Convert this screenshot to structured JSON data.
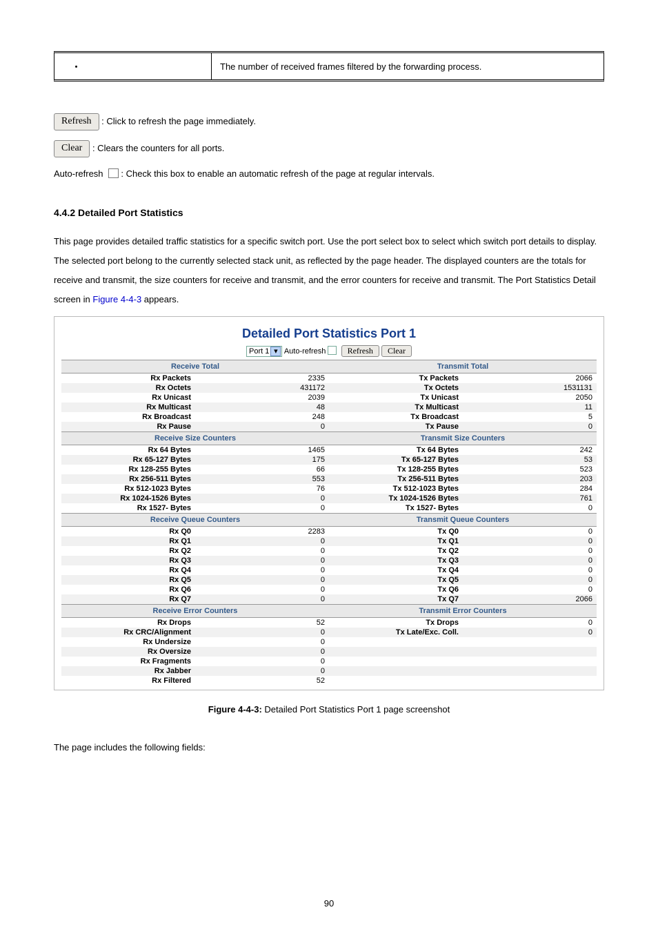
{
  "top_row": {
    "desc": "The number of received frames filtered by the forwarding process."
  },
  "buttons": {
    "refresh": "Refresh",
    "clear": "Clear",
    "refresh_desc": "Click to refresh the page immediately.",
    "clear_desc": ": Clears the counters for all ports.",
    "autorefresh_prefix": "Auto-refresh",
    "autorefresh_desc": ": Check this box to enable an automatic refresh of the page at regular intervals."
  },
  "section": {
    "heading": "4.4.2 Detailed Port Statistics",
    "para": "This page provides detailed traffic statistics for a specific switch port. Use the port select box to select which switch port details to display. The selected port belong to the currently selected stack unit, as reflected by the page header. The displayed counters are the totals for receive and transmit, the size counters for receive and transmit, and the error counters for receive and transmit. The Port Statistics Detail screen in ",
    "figref": "Figure 4-4-3",
    "para_tail": " appears."
  },
  "shot": {
    "title": "Detailed Port Statistics  Port 1",
    "port_select": "Port 1",
    "autorefresh_label": "Auto-refresh",
    "refresh": "Refresh",
    "clear": "Clear",
    "groups": {
      "rx_total": "Receive Total",
      "tx_total": "Transmit Total",
      "rx_size": "Receive Size Counters",
      "tx_size": "Transmit Size Counters",
      "rx_queue": "Receive Queue Counters",
      "tx_queue": "Transmit Queue Counters",
      "rx_err": "Receive Error Counters",
      "tx_err": "Transmit Error Counters"
    },
    "rows": {
      "total": [
        {
          "rl": "Rx Packets",
          "rv": "2335",
          "tl": "Tx Packets",
          "tv": "2066"
        },
        {
          "rl": "Rx Octets",
          "rv": "431172",
          "tl": "Tx Octets",
          "tv": "1531131"
        },
        {
          "rl": "Rx Unicast",
          "rv": "2039",
          "tl": "Tx Unicast",
          "tv": "2050"
        },
        {
          "rl": "Rx Multicast",
          "rv": "48",
          "tl": "Tx Multicast",
          "tv": "11"
        },
        {
          "rl": "Rx Broadcast",
          "rv": "248",
          "tl": "Tx Broadcast",
          "tv": "5"
        },
        {
          "rl": "Rx Pause",
          "rv": "0",
          "tl": "Tx Pause",
          "tv": "0"
        }
      ],
      "size": [
        {
          "rl": "Rx 64 Bytes",
          "rv": "1465",
          "tl": "Tx 64 Bytes",
          "tv": "242"
        },
        {
          "rl": "Rx 65-127 Bytes",
          "rv": "175",
          "tl": "Tx 65-127 Bytes",
          "tv": "53"
        },
        {
          "rl": "Rx 128-255 Bytes",
          "rv": "66",
          "tl": "Tx 128-255 Bytes",
          "tv": "523"
        },
        {
          "rl": "Rx 256-511 Bytes",
          "rv": "553",
          "tl": "Tx 256-511 Bytes",
          "tv": "203"
        },
        {
          "rl": "Rx 512-1023 Bytes",
          "rv": "76",
          "tl": "Tx 512-1023 Bytes",
          "tv": "284"
        },
        {
          "rl": "Rx 1024-1526 Bytes",
          "rv": "0",
          "tl": "Tx 1024-1526 Bytes",
          "tv": "761"
        },
        {
          "rl": "Rx 1527- Bytes",
          "rv": "0",
          "tl": "Tx 1527- Bytes",
          "tv": "0"
        }
      ],
      "queue": [
        {
          "rl": "Rx Q0",
          "rv": "2283",
          "tl": "Tx Q0",
          "tv": "0"
        },
        {
          "rl": "Rx Q1",
          "rv": "0",
          "tl": "Tx Q1",
          "tv": "0"
        },
        {
          "rl": "Rx Q2",
          "rv": "0",
          "tl": "Tx Q2",
          "tv": "0"
        },
        {
          "rl": "Rx Q3",
          "rv": "0",
          "tl": "Tx Q3",
          "tv": "0"
        },
        {
          "rl": "Rx Q4",
          "rv": "0",
          "tl": "Tx Q4",
          "tv": "0"
        },
        {
          "rl": "Rx Q5",
          "rv": "0",
          "tl": "Tx Q5",
          "tv": "0"
        },
        {
          "rl": "Rx Q6",
          "rv": "0",
          "tl": "Tx Q6",
          "tv": "0"
        },
        {
          "rl": "Rx Q7",
          "rv": "0",
          "tl": "Tx Q7",
          "tv": "2066"
        }
      ],
      "err": [
        {
          "rl": "Rx Drops",
          "rv": "52",
          "tl": "Tx Drops",
          "tv": "0"
        },
        {
          "rl": "Rx CRC/Alignment",
          "rv": "0",
          "tl": "Tx Late/Exc. Coll.",
          "tv": "0"
        },
        {
          "rl": "Rx Undersize",
          "rv": "0",
          "tl": "",
          "tv": ""
        },
        {
          "rl": "Rx Oversize",
          "rv": "0",
          "tl": "",
          "tv": ""
        },
        {
          "rl": "Rx Fragments",
          "rv": "0",
          "tl": "",
          "tv": ""
        },
        {
          "rl": "Rx Jabber",
          "rv": "0",
          "tl": "",
          "tv": ""
        },
        {
          "rl": "Rx Filtered",
          "rv": "52",
          "tl": "",
          "tv": ""
        }
      ]
    }
  },
  "caption": "Figure 4-4-3: Detailed Port Statistics Port 1 page screenshot",
  "caption_visible": "Detailed Port Statistics Port 1 page screenshot",
  "fields_intro": "The page includes the following fields:",
  "page_number": "90"
}
